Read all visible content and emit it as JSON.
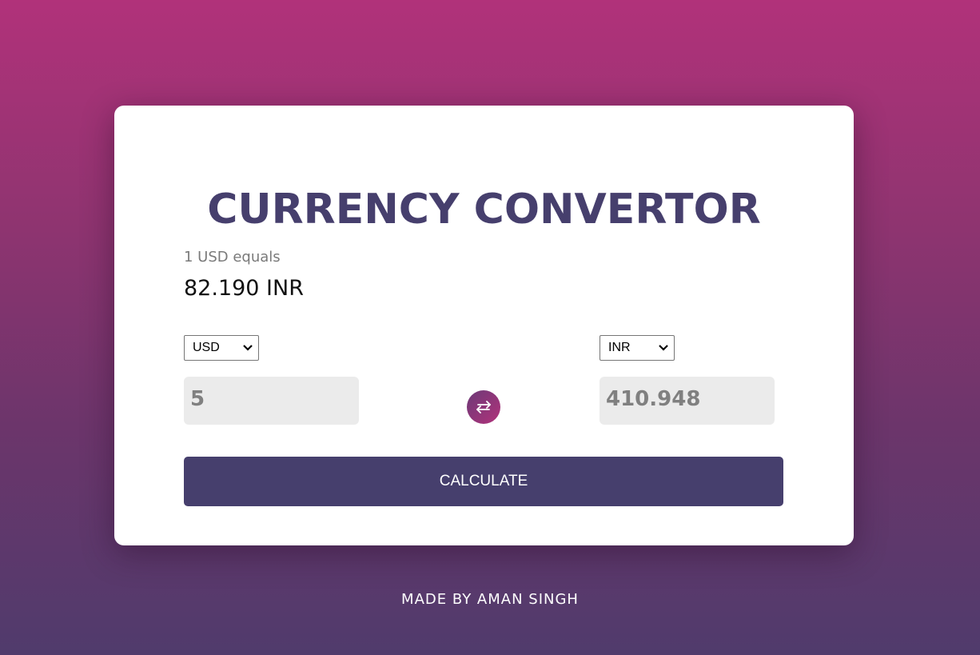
{
  "title": "CURRENCY CONVERTOR",
  "rate": {
    "label": "1 USD equals",
    "value": "82.190 INR"
  },
  "from": {
    "currency": "USD",
    "amount": "5"
  },
  "to": {
    "currency": "INR",
    "amount": "410.948"
  },
  "swap_icon": "swap-arrows-icon",
  "calculate_label": "CALCULATE",
  "footer": "MADE BY AMAN SINGH",
  "colors": {
    "primary": "#463f6d",
    "accent": "#b1327a",
    "input_bg": "#ebebeb"
  }
}
